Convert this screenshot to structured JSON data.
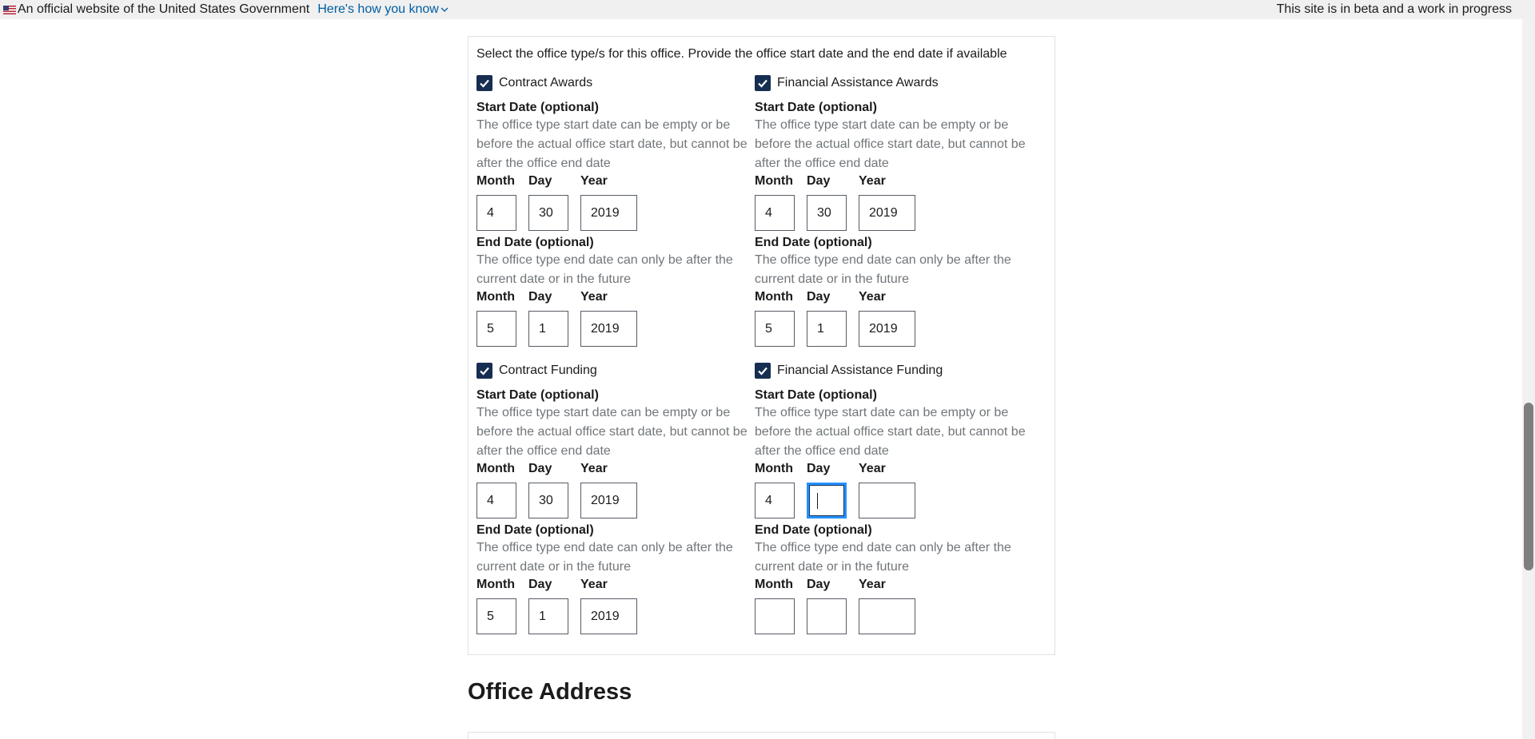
{
  "banner": {
    "official_text": "An official website of the United States Government",
    "how_link": "Here's how you know",
    "beta_text": "This site is in beta and a work in progress"
  },
  "section": {
    "instruction": "Select the office type/s for this office. Provide the office start date and the end date if available"
  },
  "labels": {
    "start_date": "Start Date (optional)",
    "end_date": "End Date (optional)",
    "start_hint": "The office type start date can be empty or be before the actual office start date, but cannot be after the office end date",
    "end_hint": "The office type end date can only be after the current date or in the future",
    "month": "Month",
    "day": "Day",
    "year": "Year"
  },
  "office_types": [
    {
      "label": "Contract Awards",
      "checked": true,
      "start": {
        "month": "4",
        "day": "30",
        "year": "2019"
      },
      "end": {
        "month": "5",
        "day": "1",
        "year": "2019"
      }
    },
    {
      "label": "Financial Assistance Awards",
      "checked": true,
      "start": {
        "month": "4",
        "day": "30",
        "year": "2019"
      },
      "end": {
        "month": "5",
        "day": "1",
        "year": "2019"
      }
    },
    {
      "label": "Contract Funding",
      "checked": true,
      "start": {
        "month": "4",
        "day": "30",
        "year": "2019"
      },
      "end": {
        "month": "5",
        "day": "1",
        "year": "2019"
      }
    },
    {
      "label": "Financial Assistance Funding",
      "checked": true,
      "start": {
        "month": "4",
        "day": "",
        "year": ""
      },
      "end": {
        "month": "",
        "day": "",
        "year": ""
      }
    }
  ],
  "office_address_heading": "Office Address",
  "colors": {
    "primary_dark": "#162e51",
    "link": "#005ea2",
    "focus": "#2491ff",
    "hint": "#71767a"
  }
}
